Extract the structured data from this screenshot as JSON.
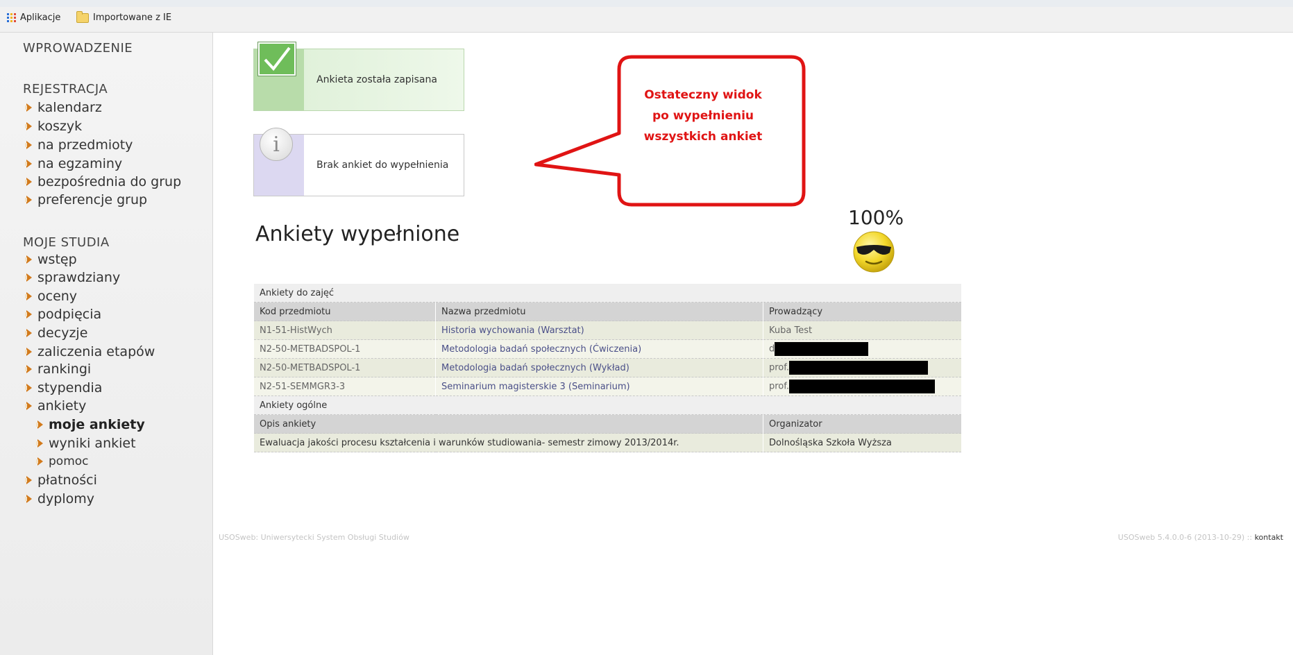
{
  "browser": {
    "bookmarks": [
      {
        "label": "Aplikacje",
        "icon": "apps-grid-icon"
      },
      {
        "label": "Importowane z IE",
        "icon": "folder-icon"
      }
    ]
  },
  "sidebar": {
    "intro": "WPROWADZENIE",
    "registration": {
      "title": "REJESTRACJA",
      "items": [
        "kalendarz",
        "koszyk",
        "na przedmioty",
        "na egzaminy",
        "bezpośrednia do grup",
        "preferencje grup"
      ]
    },
    "studies": {
      "title": "MOJE STUDIA",
      "items": [
        "wstęp",
        "sprawdziany",
        "oceny",
        "podpięcia",
        "decyzje",
        "zaliczenia etapów",
        "rankingi",
        "stypendia",
        "ankiety"
      ],
      "subitems": [
        "moje ankiety",
        "wyniki ankiet",
        "pomoc"
      ],
      "after": [
        "płatności",
        "dyplomy"
      ]
    }
  },
  "messages": {
    "saved": "Ankieta została zapisana",
    "none": "Brak ankiet do wypełnienia"
  },
  "callout": {
    "line1": "Ostateczny widok",
    "line2": "po wypełnieniu",
    "line3": "wszystkich ankiet",
    "color": "#e01414"
  },
  "main": {
    "title": "Ankiety wypełnione",
    "percent": "100%"
  },
  "table": {
    "group1": "Ankiety do zajęć",
    "headers1": [
      "Kod przedmiotu",
      "Nazwa przedmiotu",
      "Prowadzący"
    ],
    "rows": [
      {
        "code": "N1-51-HistWych",
        "name": "Historia wychowania (Warsztat)",
        "teacher": "Kuba Test"
      },
      {
        "code": "N2-50-METBADSPOL-1",
        "name": "Metodologia badań społecznych (Ćwiczenia)",
        "teacher": "d"
      },
      {
        "code": "N2-50-METBADSPOL-1",
        "name": "Metodologia badań społecznych (Wykład)",
        "teacher": "prof."
      },
      {
        "code": "N2-51-SEMMGR3-3",
        "name": "Seminarium magisterskie 3 (Seminarium)",
        "teacher": "prof."
      }
    ],
    "group2": "Ankiety ogólne",
    "headers2": [
      "Opis ankiety",
      "Organizator"
    ],
    "general": {
      "description": "Ewaluacja jakości procesu kształcenia i warunków studiowania- semestr zimowy 2013/2014r.",
      "organizer": "Dolnośląska Szkoła Wyższa"
    }
  },
  "footer": {
    "left": "USOSweb: Uniwersytecki System Obsługi Studiów",
    "version": "USOSweb 5.4.0.0-6 (2013-10-29) ::",
    "contact": "kontakt"
  }
}
